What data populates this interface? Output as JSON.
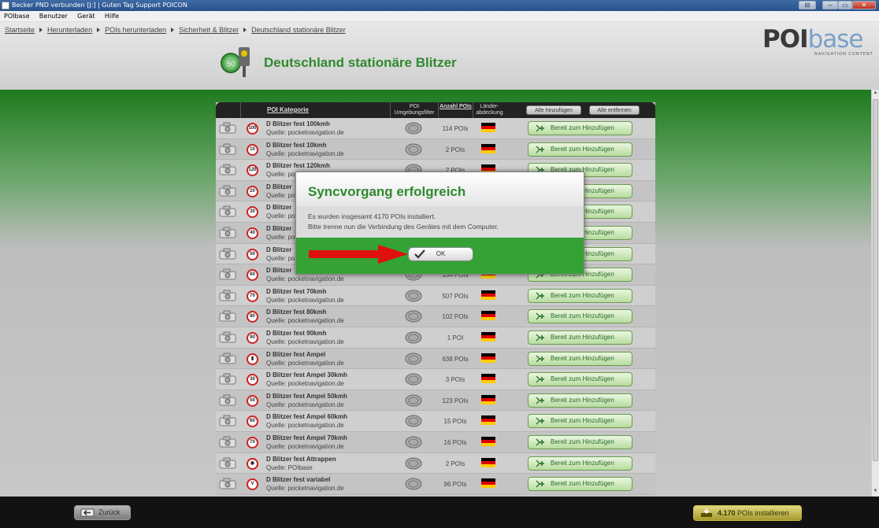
{
  "window": {
    "title": "Becker PND verbunden [J:] | Guten Tag Support POICON",
    "controls": [
      "⊟",
      "–",
      "▭",
      "✕"
    ]
  },
  "menu": [
    "POIbase",
    "Benutzer",
    "Gerät",
    "Hilfe"
  ],
  "breadcrumb": [
    "Startseite",
    "Herunterladen",
    "POIs herunterladen",
    "Sicherheit & Blitzer",
    "Deutschland stationäre Blitzer"
  ],
  "logo": {
    "poi": "POI",
    "base": "base",
    "tagline": "NAVIGATION CONTENT"
  },
  "page_title": "Deutschland stationäre Blitzer",
  "category_icon_text": "50",
  "table": {
    "headers": {
      "category": "POI Kategorie",
      "filter": "POI Umgebungsfilter",
      "count": "Anzahl POIs",
      "coverage": "Länder-abdeckung"
    },
    "add_all": "Alle hinzufügen",
    "remove_all": "Alle entfernen",
    "add_label": "Bereit zum Hinzufügen",
    "rows": [
      {
        "sign": "100",
        "name": "D Blitzer fest 100kmh",
        "source": "Quelle: pocketnavigation.de",
        "count": "114 POIs"
      },
      {
        "sign": "10",
        "name": "D Blitzer fest 10kmh",
        "source": "Quelle: pocketnavigation.de",
        "count": "2 POIs"
      },
      {
        "sign": "120",
        "name": "D Blitzer fest 120kmh",
        "source": "Quelle: po",
        "count": "2 POIs"
      },
      {
        "sign": "20",
        "name": "D Blitzer",
        "source": "Quelle: po",
        "count": ""
      },
      {
        "sign": "30",
        "name": "D Blitzer",
        "source": "Quelle: po",
        "count": ""
      },
      {
        "sign": "40",
        "name": "D Blitzer",
        "source": "Quelle: po",
        "count": ""
      },
      {
        "sign": "50",
        "name": "D Blitzer",
        "source": "Quelle: po",
        "count": ""
      },
      {
        "sign": "60",
        "name": "D Blitzer",
        "source": "Quelle: pocketnavigation.de",
        "count": "154 POIs"
      },
      {
        "sign": "70",
        "name": "D Blitzer fest 70kmh",
        "source": "Quelle: pocketnavigation.de",
        "count": "507 POIs"
      },
      {
        "sign": "80",
        "name": "D Blitzer fest 80kmh",
        "source": "Quelle: pocketnavigation.de",
        "count": "102 POIs"
      },
      {
        "sign": "90",
        "name": "D Blitzer fest 90kmh",
        "source": "Quelle: pocketnavigation.de",
        "count": "1 POI"
      },
      {
        "sign": "▮",
        "name": "D Blitzer fest Ampel",
        "source": "Quelle: pocketnavigation.de",
        "count": "638 POIs"
      },
      {
        "sign": "30",
        "name": "D Blitzer fest Ampel 30kmh",
        "source": "Quelle: pocketnavigation.de",
        "count": "3 POIs"
      },
      {
        "sign": "50",
        "name": "D Blitzer fest Ampel 50kmh",
        "source": "Quelle: pocketnavigation.de",
        "count": "123 POIs"
      },
      {
        "sign": "60",
        "name": "D Blitzer fest Ampel 60kmh",
        "source": "Quelle: pocketnavigation.de",
        "count": "15 POIs"
      },
      {
        "sign": "70",
        "name": "D Blitzer fest Ampel 70kmh",
        "source": "Quelle: pocketnavigation.de",
        "count": "16 POIs"
      },
      {
        "sign": "◉",
        "name": "D Blitzer fest Attrappen",
        "source": "Quelle: POIbase",
        "count": "2 POIs"
      },
      {
        "sign": "V",
        "name": "D Blitzer fest variabel",
        "source": "Quelle: pocketnavigation.de",
        "count": "96 POIs"
      }
    ]
  },
  "modal": {
    "title": "Syncvorgang erfolgreich",
    "line1": "Es wurden insgesamt 4170 POIs installiert.",
    "line2": "Bitte trenne nun die Verbindung des Gerätes mit dem Computer.",
    "ok": "OK"
  },
  "footer": {
    "back": "Zurück",
    "install_count": "4.170",
    "install_text": "POIs installieren"
  },
  "colors": {
    "accent_green": "#2f8a2f",
    "modal_footer": "#35a235",
    "arrow_red": "#e01010"
  }
}
